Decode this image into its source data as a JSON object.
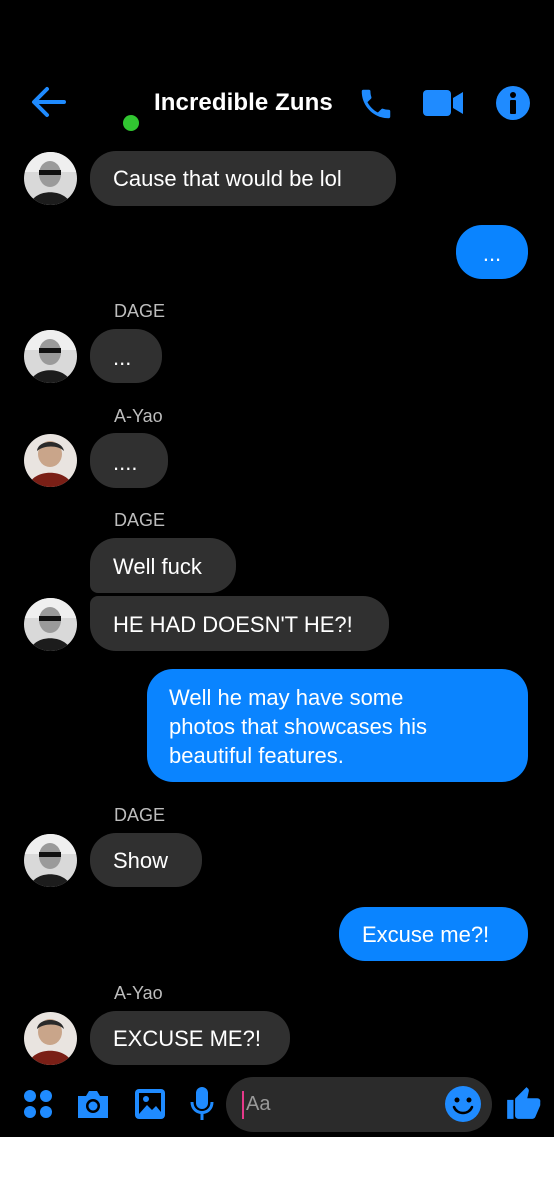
{
  "header": {
    "title": "Incredible Zuns"
  },
  "messages": [
    {
      "text": "Cause that would be lol"
    },
    {
      "text": "..."
    },
    {
      "sender": "DAGE",
      "text": "..."
    },
    {
      "sender": "A-Yao",
      "text": "...."
    },
    {
      "sender": "DAGE",
      "text": "Well fuck"
    },
    {
      "text": "HE HAD DOESN'T HE?!"
    },
    {
      "lines": [
        "Well he may have some",
        "photos that showcases his",
        "beautiful features."
      ]
    },
    {
      "sender": "DAGE",
      "text": "Show"
    },
    {
      "text": "Excuse me?!"
    },
    {
      "sender": "A-Yao",
      "text": "EXCUSE ME?!"
    }
  ],
  "composer": {
    "placeholder": "Aa"
  },
  "colors": {
    "accent": "#0a84ff",
    "incoming_bubble": "#303030",
    "online": "#31c631"
  },
  "icons": [
    "back-arrow-icon",
    "phone-icon",
    "video-camera-icon",
    "info-icon",
    "apps-grid-icon",
    "camera-icon",
    "image-icon",
    "microphone-icon",
    "emoji-icon",
    "thumbs-up-icon"
  ]
}
